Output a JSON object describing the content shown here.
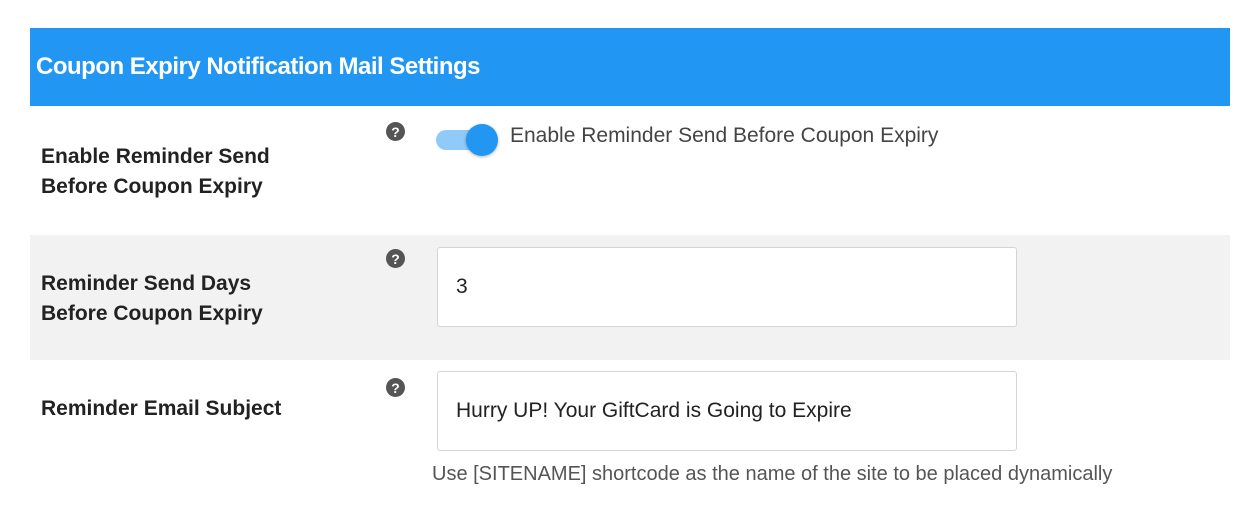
{
  "header": {
    "title": "Coupon Expiry Notification Mail Settings"
  },
  "colors": {
    "accent": "#2196f3",
    "toggle_track": "#90caf9",
    "alt_row": "#f2f2f2"
  },
  "rows": [
    {
      "label": "Enable Reminder Send Before Coupon Expiry",
      "label_line1": "Enable Reminder Send",
      "label_line2": "Before Coupon Expiry",
      "help_icon": "?",
      "toggle": {
        "state": "on",
        "label": "Enable Reminder Send Before Coupon Expiry"
      }
    },
    {
      "label": "Reminder Send Days Before Coupon Expiry",
      "label_line1": "Reminder Send Days",
      "label_line2": "Before Coupon Expiry",
      "help_icon": "?",
      "value": "3"
    },
    {
      "label": "Reminder Email Subject",
      "help_icon": "?",
      "value": "Hurry UP! Your GiftCard is Going to Expire",
      "hint": "Use [SITENAME] shortcode as the name of the site to be placed dynamically"
    }
  ]
}
